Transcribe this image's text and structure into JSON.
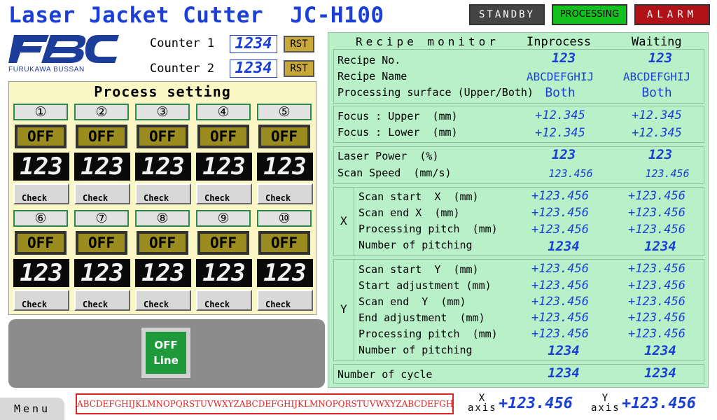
{
  "app": {
    "title": "Laser Jacket Cutter  JC-H100"
  },
  "status": {
    "standby": "STANDBY",
    "processing": "PROCESSING",
    "alarm": "ALARM",
    "standby_color": "#444444",
    "processing_color": "#12c01e",
    "alarm_color": "#b01218"
  },
  "logo": {
    "main": "FBC",
    "sub": "FURUKAWA BUSSAN",
    "color": "#1c3d9a"
  },
  "counters": [
    {
      "label": "Counter 1",
      "value": "1234",
      "reset": "RST"
    },
    {
      "label": "Counter 2",
      "value": "1234",
      "reset": "RST"
    }
  ],
  "process": {
    "title": "Process setting",
    "cells": [
      {
        "num": "①",
        "state": "OFF",
        "value": "123",
        "check": "Check"
      },
      {
        "num": "②",
        "state": "OFF",
        "value": "123",
        "check": "Check"
      },
      {
        "num": "③",
        "state": "OFF",
        "value": "123",
        "check": "Check"
      },
      {
        "num": "④",
        "state": "OFF",
        "value": "123",
        "check": "Check"
      },
      {
        "num": "⑤",
        "state": "OFF",
        "value": "123",
        "check": "Check"
      },
      {
        "num": "⑥",
        "state": "OFF",
        "value": "123",
        "check": "Check"
      },
      {
        "num": "⑦",
        "state": "OFF",
        "value": "123",
        "check": "Check"
      },
      {
        "num": "⑧",
        "state": "OFF",
        "value": "123",
        "check": "Check"
      },
      {
        "num": "⑨",
        "state": "OFF",
        "value": "123",
        "check": "Check"
      },
      {
        "num": "⑩",
        "state": "OFF",
        "value": "123",
        "check": "Check"
      }
    ]
  },
  "offline": {
    "line1": "OFF",
    "line2": "Line"
  },
  "recipe": {
    "title": "Recipe monitor",
    "col_inprocess": "Inprocess",
    "col_waiting": "Waiting",
    "recipe_no": {
      "label": "Recipe No.",
      "inprocess": "123",
      "waiting": "123"
    },
    "recipe_name": {
      "label": "Recipe Name",
      "inprocess": "ABCDEFGHIJ",
      "waiting": "ABCDEFGHIJ"
    },
    "surface": {
      "label": "Processing surface (Upper/Both)",
      "inprocess": "Both",
      "waiting": "Both"
    },
    "focus_upper": {
      "label": "Focus : Upper  (mm)",
      "inprocess": "+12.345",
      "waiting": "+12.345"
    },
    "focus_lower": {
      "label": "Focus : Lower  (mm)",
      "inprocess": "+12.345",
      "waiting": "+12.345"
    },
    "laser_power": {
      "label": "Laser Power  (%)",
      "inprocess": "123",
      "waiting": "123"
    },
    "scan_speed": {
      "label": "Scan Speed  (mm/s)",
      "inprocess": "123.456",
      "waiting": "123.456"
    },
    "x_group": {
      "axis": "X",
      "rows": [
        {
          "label": "Scan start  X  (mm)",
          "inprocess": "+123.456",
          "waiting": "+123.456"
        },
        {
          "label": "Scan end X  (mm)",
          "inprocess": "+123.456",
          "waiting": "+123.456"
        },
        {
          "label": "Processing pitch  (mm)",
          "inprocess": "+123.456",
          "waiting": "+123.456"
        },
        {
          "label": "Number of pitching",
          "inprocess": "1234",
          "waiting": "1234"
        }
      ]
    },
    "y_group": {
      "axis": "Y",
      "rows": [
        {
          "label": "Scan start  Y  (mm)",
          "inprocess": "+123.456",
          "waiting": "+123.456"
        },
        {
          "label": "Start adjustment (mm)",
          "inprocess": "+123.456",
          "waiting": "+123.456"
        },
        {
          "label": "Scan end  Y  (mm)",
          "inprocess": "+123.456",
          "waiting": "+123.456"
        },
        {
          "label": "End adjustment  (mm)",
          "inprocess": "+123.456",
          "waiting": "+123.456"
        },
        {
          "label": "Processing pitch  (mm)",
          "inprocess": "+123.456",
          "waiting": "+123.456"
        },
        {
          "label": "Number of pitching",
          "inprocess": "1234",
          "waiting": "1234"
        }
      ]
    },
    "cycle": {
      "label": "Number of cycle",
      "inprocess": "1234",
      "waiting": "1234"
    }
  },
  "footer": {
    "menu": "Menu",
    "ticker": "ABCDEFGHIJKLMNOPQRSTUVWXYZABCDEFGHIJKLMNOPQRSTUVWXYZABCDEFGHIJKLM",
    "x_axis_top": "X",
    "x_axis_bottom": "axis",
    "x_value": "+123.456",
    "y_axis_top": "Y",
    "y_axis_bottom": "axis",
    "y_value": "+123.456"
  }
}
